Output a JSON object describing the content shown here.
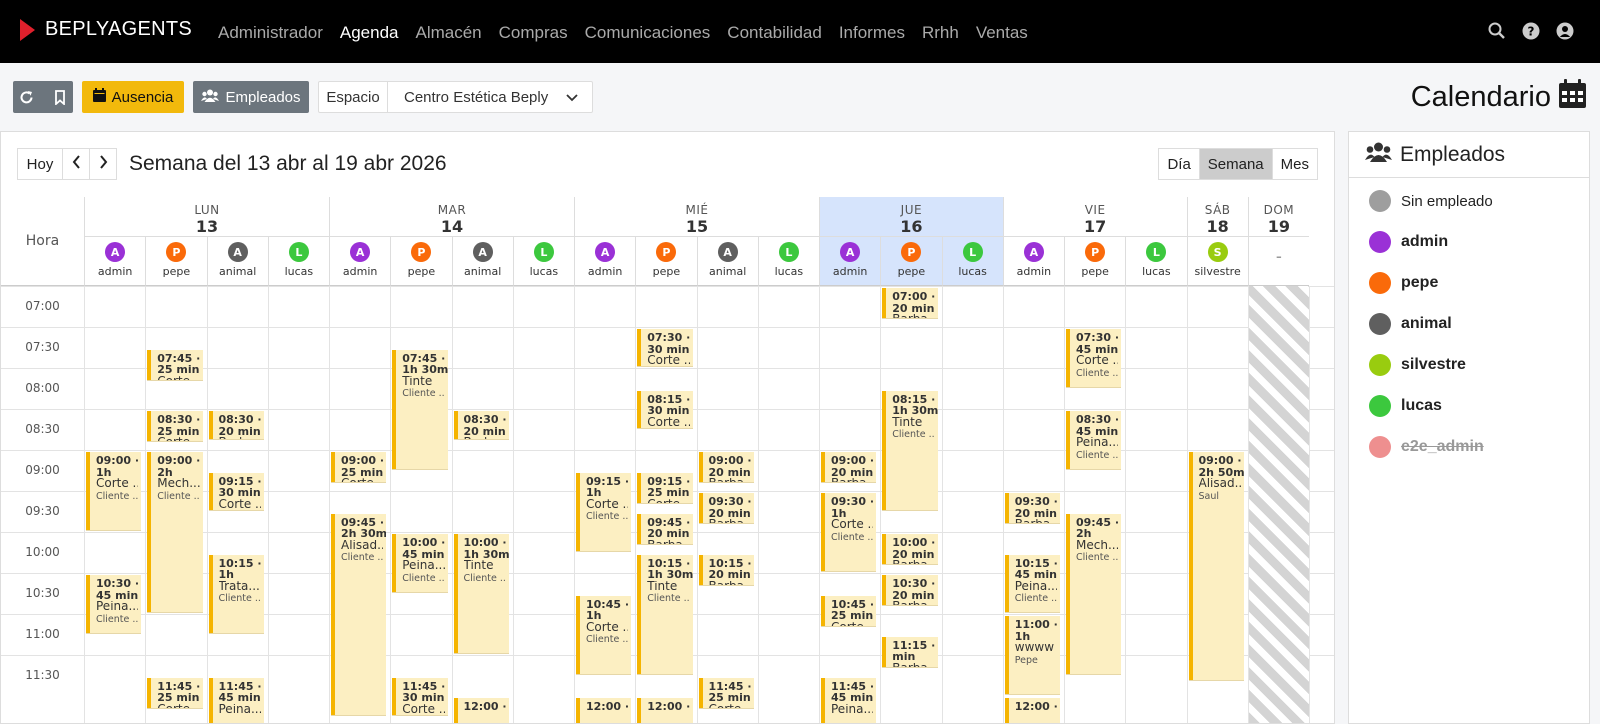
{
  "app": {
    "brand": "BEPLYAGENTS"
  },
  "nav": {
    "items": [
      {
        "label": "Administrador",
        "active": false
      },
      {
        "label": "Agenda",
        "active": true
      },
      {
        "label": "Almacén",
        "active": false
      },
      {
        "label": "Compras",
        "active": false
      },
      {
        "label": "Comunicaciones",
        "active": false
      },
      {
        "label": "Contabilidad",
        "active": false
      },
      {
        "label": "Informes",
        "active": false
      },
      {
        "label": "Rrhh",
        "active": false
      },
      {
        "label": "Ventas",
        "active": false
      }
    ]
  },
  "toolbar": {
    "ausencia_label": "Ausencia",
    "empleados_label": "Empleados",
    "espacio_label": "Espacio",
    "espacio_value": "Centro Estética Beply"
  },
  "page": {
    "title": "Calendario"
  },
  "calendar": {
    "today_label": "Hoy",
    "week_title": "Semana del 13 abr al 19 abr 2026",
    "views": [
      {
        "label": "Día",
        "active": false
      },
      {
        "label": "Semana",
        "active": true
      },
      {
        "label": "Mes",
        "active": false
      }
    ],
    "hora_label": "Hora",
    "times": [
      "07:00",
      "07:30",
      "08:00",
      "08:30",
      "09:00",
      "09:30",
      "10:00",
      "10:30",
      "11:00",
      "11:30"
    ],
    "days": [
      {
        "dow": "LUN",
        "num": "13",
        "employees": [
          "admin",
          "pepe",
          "animal",
          "lucas"
        ]
      },
      {
        "dow": "MAR",
        "num": "14",
        "employees": [
          "admin",
          "pepe",
          "animal",
          "lucas"
        ]
      },
      {
        "dow": "MIÉ",
        "num": "15",
        "employees": [
          "admin",
          "pepe",
          "animal",
          "lucas"
        ]
      },
      {
        "dow": "JUE",
        "num": "16",
        "employees": [
          "admin",
          "pepe",
          "lucas"
        ],
        "today": true
      },
      {
        "dow": "VIE",
        "num": "17",
        "employees": [
          "admin",
          "pepe",
          "lucas"
        ]
      },
      {
        "dow": "SÁB",
        "num": "18",
        "employees": [
          "silvestre"
        ]
      },
      {
        "dow": "DOM",
        "num": "19",
        "employees": [
          "–"
        ],
        "closed": true
      }
    ],
    "events": [
      {
        "col": 0,
        "start": "09:00",
        "dur": 60,
        "time": "09:00 ·",
        "len": "1h",
        "name": "Corte ...",
        "client": "Cliente ..."
      },
      {
        "col": 0,
        "start": "10:30",
        "dur": 45,
        "time": "10:30 ·",
        "len": "45 min",
        "name": "Peina...",
        "client": "Cliente ..."
      },
      {
        "col": 1,
        "start": "07:45",
        "dur": 25,
        "time": "07:45 ·",
        "len": "25 min",
        "name": "Corte ..."
      },
      {
        "col": 1,
        "start": "08:30",
        "dur": 25,
        "time": "08:30 ·",
        "len": "25 min",
        "name": "Corte ..."
      },
      {
        "col": 1,
        "start": "09:00",
        "dur": 120,
        "time": "09:00 ·",
        "len": "2h",
        "name": "Mech...",
        "client": "Cliente ..."
      },
      {
        "col": 1,
        "start": "11:45",
        "dur": 25,
        "time": "11:45 ·",
        "len": "25 min",
        "name": "Corte ..."
      },
      {
        "col": 2,
        "start": "08:30",
        "dur": 20,
        "time": "08:30 ·",
        "len": "20 min",
        "name": "Barba ..."
      },
      {
        "col": 2,
        "start": "09:15",
        "dur": 30,
        "time": "09:15 ·",
        "len": "30 min",
        "name": "Corte ..."
      },
      {
        "col": 2,
        "start": "10:15",
        "dur": 60,
        "time": "10:15 ·",
        "len": "1h",
        "name": "Trata...",
        "client": "Cliente ..."
      },
      {
        "col": 2,
        "start": "11:45",
        "dur": 45,
        "time": "11:45 ·",
        "len": "45 min",
        "name": "Peina..."
      },
      {
        "col": 4,
        "start": "09:00",
        "dur": 25,
        "time": "09:00 ·",
        "len": "25 min",
        "name": "Corte ..."
      },
      {
        "col": 4,
        "start": "09:45",
        "dur": 150,
        "time": "09:45 ·",
        "len": "2h 30min",
        "name": "Alisad...",
        "client": "Cliente ..."
      },
      {
        "col": 5,
        "start": "07:45",
        "dur": 90,
        "time": "07:45 ·",
        "len": "1h 30min",
        "name": "Tinte",
        "client": "Cliente ..."
      },
      {
        "col": 5,
        "start": "10:00",
        "dur": 45,
        "time": "10:00 ·",
        "len": "45 min",
        "name": "Peina...",
        "client": "Cliente ..."
      },
      {
        "col": 5,
        "start": "11:45",
        "dur": 30,
        "time": "11:45 ·",
        "len": "30 min",
        "name": "Corte ..."
      },
      {
        "col": 6,
        "start": "08:30",
        "dur": 20,
        "time": "08:30 ·",
        "len": "20 min",
        "name": "Barba ..."
      },
      {
        "col": 6,
        "start": "10:00",
        "dur": 90,
        "time": "10:00 ·",
        "len": "1h 30min",
        "name": "Tinte",
        "client": "Cliente ..."
      },
      {
        "col": 6,
        "start": "12:00",
        "dur": 30,
        "time": "12:00 ·",
        "len": ""
      },
      {
        "col": 8,
        "start": "09:15",
        "dur": 60,
        "time": "09:15 ·",
        "len": "1h",
        "name": "Corte ...",
        "client": "Cliente ..."
      },
      {
        "col": 8,
        "start": "10:45",
        "dur": 60,
        "time": "10:45 ·",
        "len": "1h",
        "name": "Corte ...",
        "client": "Cliente ..."
      },
      {
        "col": 8,
        "start": "12:00",
        "dur": 30,
        "time": "12:00 ·",
        "len": ""
      },
      {
        "col": 9,
        "start": "07:30",
        "dur": 30,
        "time": "07:30 ·",
        "len": "30 min",
        "name": "Corte ..."
      },
      {
        "col": 9,
        "start": "08:15",
        "dur": 30,
        "time": "08:15 ·",
        "len": "30 min",
        "name": "Corte ..."
      },
      {
        "col": 9,
        "start": "09:15",
        "dur": 25,
        "time": "09:15 ·",
        "len": "25 min",
        "name": "Corte ..."
      },
      {
        "col": 9,
        "start": "09:45",
        "dur": 25,
        "time": "09:45 ·",
        "len": "20 min",
        "name": "Barba ..."
      },
      {
        "col": 9,
        "start": "10:15",
        "dur": 90,
        "time": "10:15 ·",
        "len": "1h 30min",
        "name": "Tinte",
        "client": "Cliente ..."
      },
      {
        "col": 9,
        "start": "12:00",
        "dur": 30,
        "time": "12:00 ·",
        "len": ""
      },
      {
        "col": 10,
        "start": "09:00",
        "dur": 25,
        "time": "09:00 ·",
        "len": "20 min",
        "name": "Barba ..."
      },
      {
        "col": 10,
        "start": "09:30",
        "dur": 25,
        "time": "09:30 ·",
        "len": "20 min",
        "name": "Barba ..."
      },
      {
        "col": 10,
        "start": "10:15",
        "dur": 25,
        "time": "10:15 ·",
        "len": "20 min",
        "name": "Barba ..."
      },
      {
        "col": 10,
        "start": "11:45",
        "dur": 25,
        "time": "11:45 ·",
        "len": "25 min",
        "name": "Corte ..."
      },
      {
        "col": 12,
        "start": "09:00",
        "dur": 25,
        "time": "09:00 ·",
        "len": "20 min",
        "name": "Barba ..."
      },
      {
        "col": 12,
        "start": "09:30",
        "dur": 60,
        "time": "09:30 ·",
        "len": "1h",
        "name": "Corte ...",
        "client": "Cliente ..."
      },
      {
        "col": 12,
        "start": "10:45",
        "dur": 25,
        "time": "10:45 ·",
        "len": "25 min",
        "name": "Corte ..."
      },
      {
        "col": 12,
        "start": "11:45",
        "dur": 45,
        "time": "11:45 ·",
        "len": "45 min",
        "name": "Peina..."
      },
      {
        "col": 13,
        "start": "07:00",
        "dur": 25,
        "time": "07:00 ·",
        "len": "20 min",
        "name": "Barba ..."
      },
      {
        "col": 13,
        "start": "08:15",
        "dur": 90,
        "time": "08:15 ·",
        "len": "1h 30min",
        "name": "Tinte",
        "client": "Cliente ..."
      },
      {
        "col": 13,
        "start": "10:00",
        "dur": 25,
        "time": "10:00 ·",
        "len": "20 min",
        "name": "Barba ..."
      },
      {
        "col": 13,
        "start": "10:30",
        "dur": 25,
        "time": "10:30 ·",
        "len": "20 min",
        "name": "Barba ..."
      },
      {
        "col": 13,
        "start": "11:15",
        "dur": 25,
        "time": "11:15 · 20",
        "len": "min",
        "name": "Barba ..."
      },
      {
        "col": 15,
        "start": "09:30",
        "dur": 25,
        "time": "09:30 ·",
        "len": "20 min",
        "name": "Barba ..."
      },
      {
        "col": 15,
        "start": "10:15",
        "dur": 45,
        "time": "10:15 ·",
        "len": "45 min",
        "name": "Peina...",
        "client": "Cliente ..."
      },
      {
        "col": 15,
        "start": "11:00",
        "dur": 60,
        "time": "11:00 ·",
        "len": "1h",
        "name": "wwww",
        "client": "Pepe"
      },
      {
        "col": 15,
        "start": "12:00",
        "dur": 30,
        "time": "12:00 ·",
        "len": ""
      },
      {
        "col": 16,
        "start": "07:30",
        "dur": 45,
        "time": "07:30 ·",
        "len": "45 min",
        "name": "Corte ...",
        "client": "Cliente ..."
      },
      {
        "col": 16,
        "start": "08:30",
        "dur": 45,
        "time": "08:30 ·",
        "len": "45 min",
        "name": "Peina...",
        "client": "Cliente ..."
      },
      {
        "col": 16,
        "start": "09:45",
        "dur": 120,
        "time": "09:45 ·",
        "len": "2h",
        "name": "Mech...",
        "client": "Cliente ..."
      },
      {
        "col": 18,
        "start": "09:00",
        "dur": 170,
        "time": "09:00 ·",
        "len": "2h 50m",
        "name": "Alisad...",
        "client": "Saul"
      }
    ]
  },
  "employees": {
    "title": "Empleados",
    "items": [
      {
        "name": "Sin empleado",
        "color": "#9e9e9e",
        "letter": ""
      },
      {
        "name": "admin",
        "color": "#9a31d6",
        "letter": "A"
      },
      {
        "name": "pepe",
        "color": "#fa6a0a",
        "letter": "P"
      },
      {
        "name": "animal",
        "color": "#5f5f5f",
        "letter": "A"
      },
      {
        "name": "silvestre",
        "color": "#99cc0f",
        "letter": "S"
      },
      {
        "name": "lucas",
        "color": "#3cc83e",
        "letter": "L"
      },
      {
        "name": "e2e_admin",
        "color": "#ee8f8f",
        "letter": "",
        "inactive": true
      }
    ]
  }
}
